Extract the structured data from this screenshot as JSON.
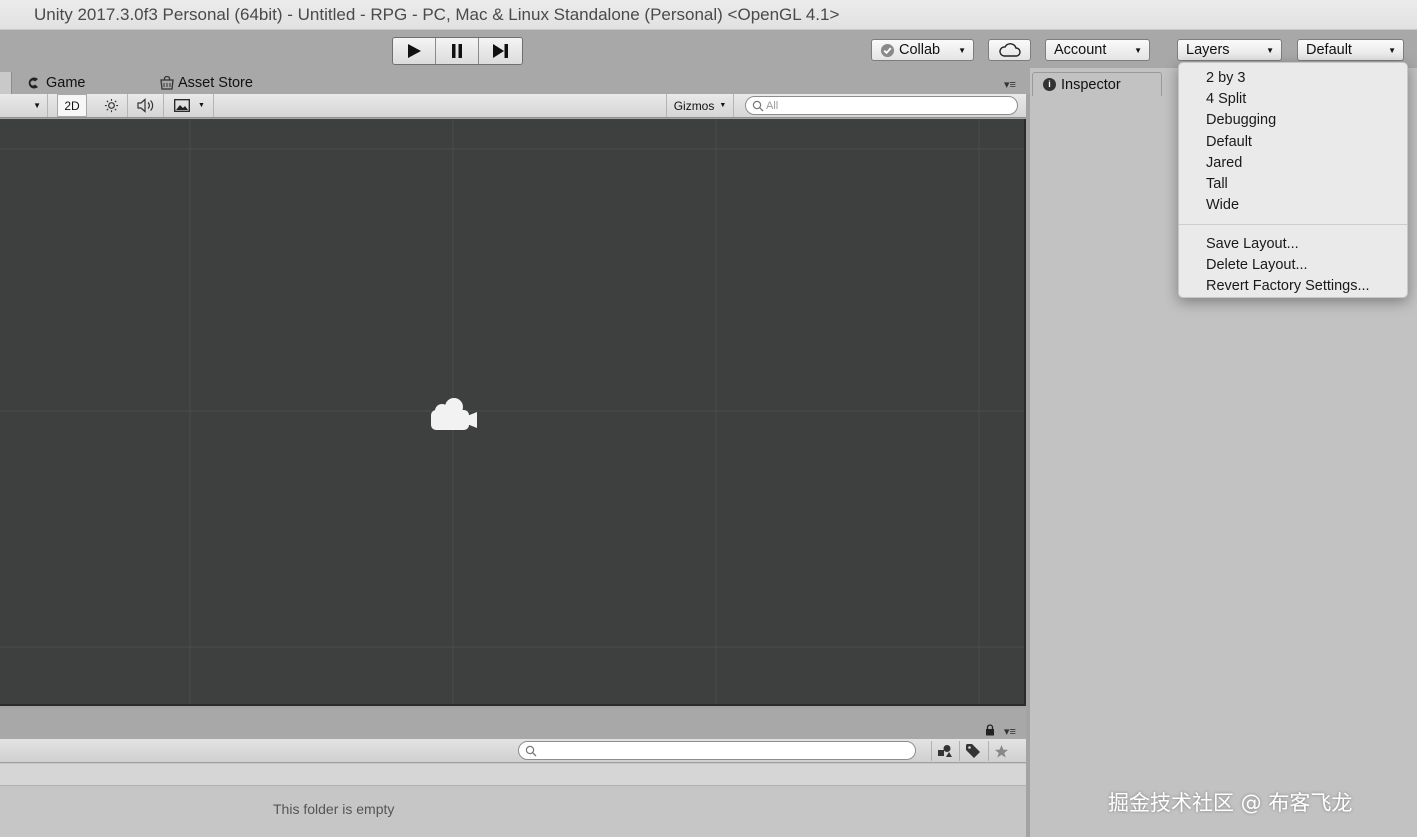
{
  "window": {
    "title": "Unity 2017.3.0f3 Personal (64bit) - Untitled - RPG - PC, Mac & Linux Standalone (Personal) <OpenGL 4.1>"
  },
  "toolbar": {
    "play_icon": "play-icon",
    "pause_icon": "pause-icon",
    "step_icon": "step-icon",
    "collab_label": "Collab",
    "account_label": "Account",
    "layers_label": "Layers",
    "layout_label": "Default"
  },
  "tabs": {
    "game": "Game",
    "asset_store": "Asset Store",
    "inspector": "Inspector"
  },
  "scene_toolbar": {
    "mode_2d": "2D",
    "gizmos_label": "Gizmos",
    "search_placeholder": "All"
  },
  "layout_menu": {
    "layouts": [
      "2 by 3",
      "4 Split",
      "Debugging",
      "Default",
      "Jared",
      "Tall",
      "Wide"
    ],
    "actions": [
      "Save Layout...",
      "Delete Layout...",
      "Revert Factory Settings..."
    ]
  },
  "project": {
    "empty_message": "This folder is empty"
  },
  "watermark": "掘金技术社区 @ 布客飞龙",
  "colors": {
    "scene_bg": "#3e3f3f",
    "panel_bg": "#c2c2c2",
    "toolbar_bg": "#a8a8a8"
  }
}
